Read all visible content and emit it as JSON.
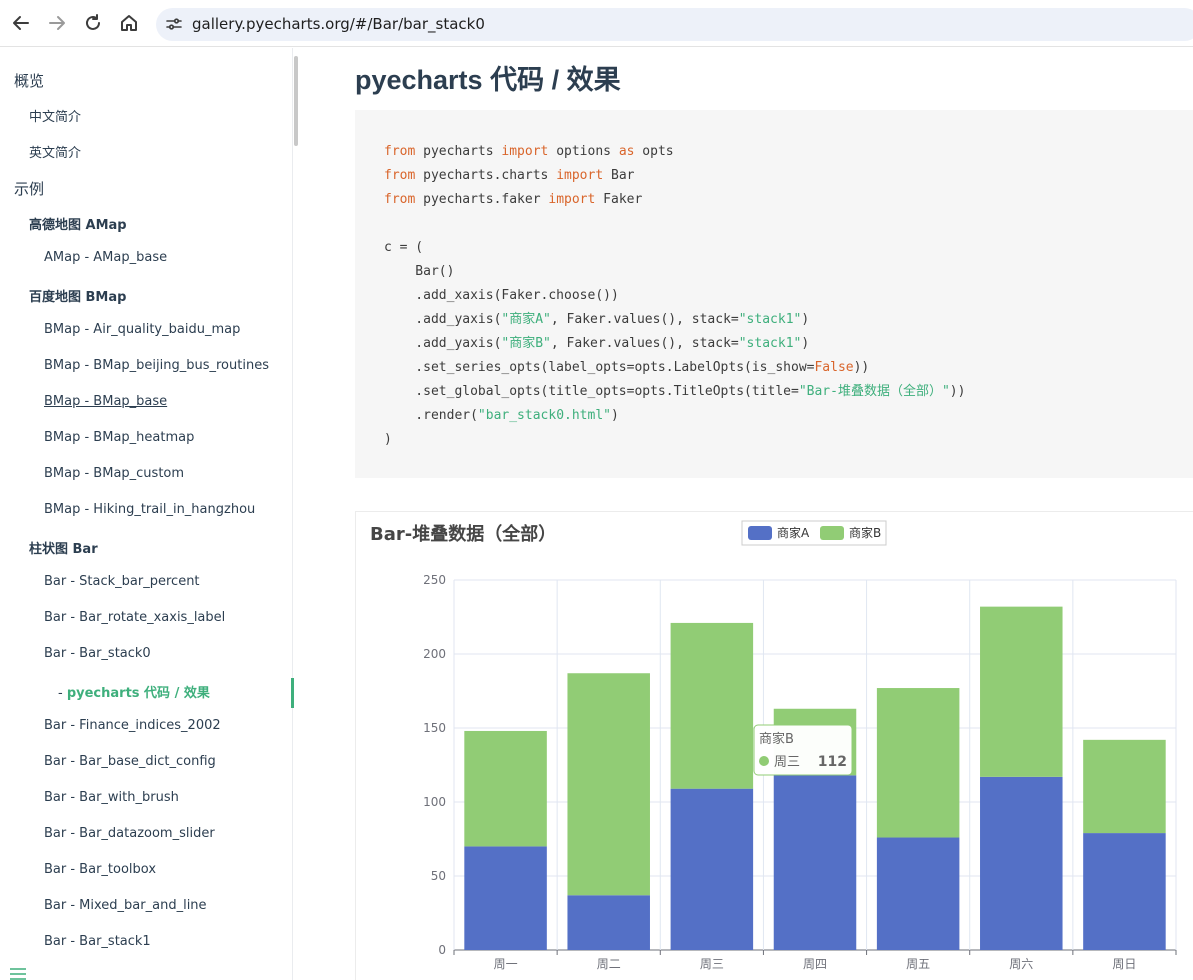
{
  "browser": {
    "url": "gallery.pyecharts.org/#/Bar/bar_stack0"
  },
  "sidebar": {
    "items": [
      {
        "label": "概览",
        "level": "h1"
      },
      {
        "label": "中文简介",
        "level": "h2"
      },
      {
        "label": "英文简介",
        "level": "h2"
      },
      {
        "label": "示例",
        "level": "h1"
      },
      {
        "label": "高德地图 AMap",
        "level": "h2b"
      },
      {
        "label": "AMap - AMap_base",
        "level": "h3"
      },
      {
        "label": "百度地图 BMap",
        "level": "h2b"
      },
      {
        "label": "BMap - Air_quality_baidu_map",
        "level": "h3"
      },
      {
        "label": "BMap - BMap_beijing_bus_routines",
        "level": "h3"
      },
      {
        "label": "BMap - BMap_base",
        "level": "h3"
      },
      {
        "label": "BMap - BMap_heatmap",
        "level": "h3"
      },
      {
        "label": "BMap - BMap_custom",
        "level": "h3"
      },
      {
        "label": "BMap - Hiking_trail_in_hangzhou",
        "level": "h3"
      },
      {
        "label": "柱状图 Bar",
        "level": "h2b"
      },
      {
        "label": "Bar - Stack_bar_percent",
        "level": "h3"
      },
      {
        "label": "Bar - Bar_rotate_xaxis_label",
        "level": "h3"
      },
      {
        "label": "Bar - Bar_stack0",
        "level": "h3"
      },
      {
        "label": "pyecharts 代码 / 效果",
        "level": "active"
      },
      {
        "label": "Bar - Finance_indices_2002",
        "level": "h3"
      },
      {
        "label": "Bar - Bar_base_dict_config",
        "level": "h3"
      },
      {
        "label": "Bar - Bar_with_brush",
        "level": "h3"
      },
      {
        "label": "Bar - Bar_datazoom_slider",
        "level": "h3"
      },
      {
        "label": "Bar - Bar_toolbox",
        "level": "h3"
      },
      {
        "label": "Bar - Mixed_bar_and_line",
        "level": "h3"
      },
      {
        "label": "Bar - Bar_stack1",
        "level": "h3"
      }
    ]
  },
  "main": {
    "title": "pyecharts 代码 / 效果",
    "code_lines": [
      "from pyecharts import options as opts",
      "from pyecharts.charts import Bar",
      "from pyecharts.faker import Faker",
      "",
      "c = (",
      "    Bar()",
      "    .add_xaxis(Faker.choose())",
      "    .add_yaxis(\"商家A\", Faker.values(), stack=\"stack1\")",
      "    .add_yaxis(\"商家B\", Faker.values(), stack=\"stack1\")",
      "    .set_series_opts(label_opts=opts.LabelOpts(is_show=False))",
      "    .set_global_opts(title_opts=opts.TitleOpts(title=\"Bar-堆叠数据（全部）\"))",
      "    .render(\"bar_stack0.html\")",
      ")"
    ]
  },
  "chart_data": {
    "type": "bar",
    "title": "Bar-堆叠数据（全部）",
    "stacked": true,
    "categories": [
      "周一",
      "周二",
      "周三",
      "周四",
      "周五",
      "周六",
      "周日"
    ],
    "series": [
      {
        "name": "商家A",
        "values": [
          70,
          37,
          109,
          118,
          76,
          117,
          79
        ],
        "color": "#5470c6"
      },
      {
        "name": "商家B",
        "values": [
          78,
          150,
          112,
          45,
          101,
          115,
          63
        ],
        "color": "#91cc75"
      }
    ],
    "ylim": [
      0,
      250
    ],
    "yticks": [
      0,
      50,
      100,
      150,
      200,
      250
    ],
    "legend_position": "top-center",
    "grid": true,
    "tooltip": {
      "series": "商家B",
      "category": "周三",
      "value": "112"
    }
  }
}
